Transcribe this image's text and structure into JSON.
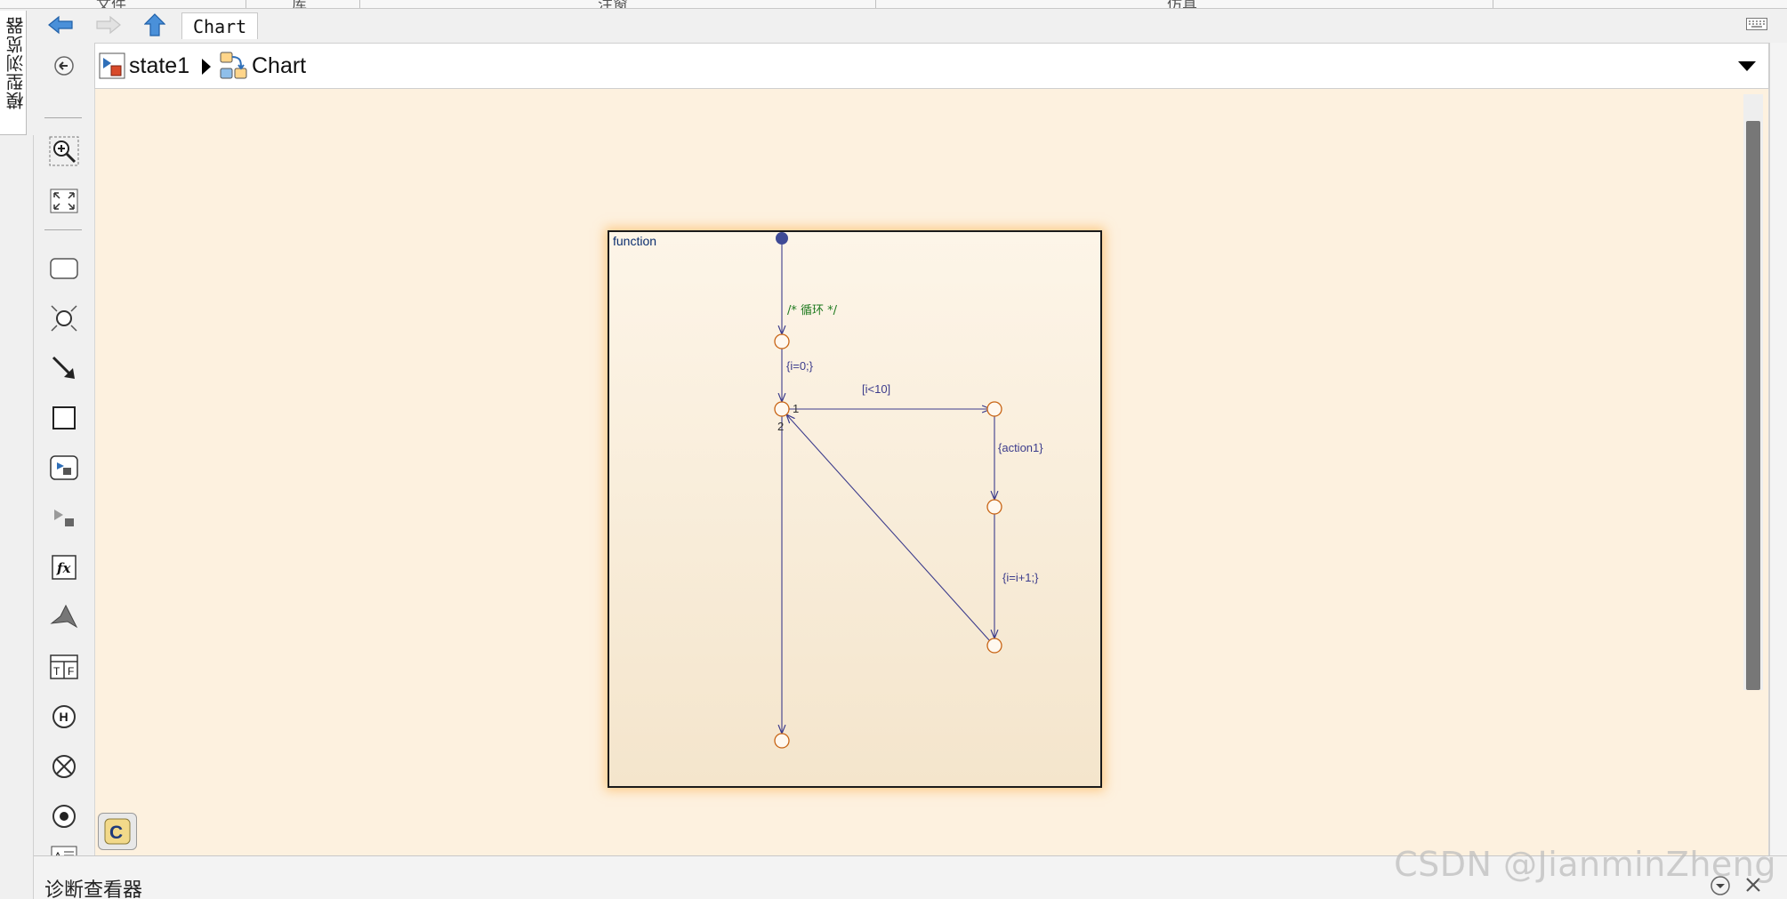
{
  "ribbon": {
    "tabs": [
      "文件",
      "库",
      "注窗",
      "仿真"
    ]
  },
  "left_panel": {
    "model_browser_label": "模型浏览器"
  },
  "nav": {
    "current_tab": "Chart"
  },
  "breadcrumb": {
    "items": [
      "state1",
      "Chart"
    ]
  },
  "palette": {
    "items": [
      "hide-show-icon",
      "zoom-icon",
      "fit-view-icon",
      "state-tool-icon",
      "junction-tool-icon",
      "transition-tool-icon",
      "box-tool-icon",
      "subchart-tool-icon",
      "simulink-state-icon",
      "graphical-function-icon",
      "matlab-function-icon",
      "truth-table-icon",
      "history-junction-icon",
      "exit-junction-icon",
      "entry-junction-icon",
      "annotation-icon"
    ]
  },
  "diagram": {
    "state_name": "function",
    "labels": {
      "comment": "/* 循环 */",
      "init": "{i=0;}",
      "cond": "[i<10]",
      "action": "{action1}",
      "inc": "{i=i+1;}",
      "order1": "1",
      "order2": "2"
    },
    "colors": {
      "junction": "#c86414",
      "transition": "#3c3c8c",
      "default_dot": "#3f4a96",
      "comment": "#1f7a1f",
      "literal": "#c81ec8",
      "state_border": "#1a1a1a",
      "glow": "#ffaa3c"
    }
  },
  "diagnostics": {
    "title": "诊断查看器"
  },
  "watermark": {
    "text": "CSDN @JianminZheng"
  }
}
